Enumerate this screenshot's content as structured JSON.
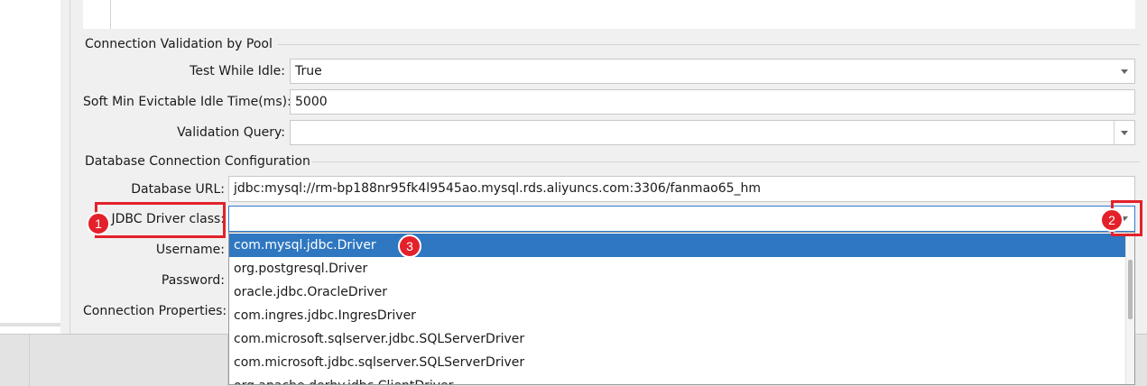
{
  "sections": {
    "validation_title": "Connection Validation by Pool",
    "db_config_title": "Database Connection Configuration"
  },
  "fields": {
    "test_while_idle": {
      "label": "Test While Idle:",
      "value": "True"
    },
    "soft_min_idle": {
      "label": "Soft Min Evictable Idle Time(ms):",
      "value": "5000"
    },
    "validation_query": {
      "label": "Validation Query:",
      "value": ""
    },
    "database_url": {
      "label": "Database URL:",
      "value": "jdbc:mysql://rm-bp188nr95fk4l9545ao.mysql.rds.aliyuncs.com:3306/fanmao65_hm"
    },
    "jdbc_driver": {
      "label": "JDBC Driver class:",
      "value": ""
    },
    "username": {
      "label": "Username:"
    },
    "password": {
      "label": "Password:"
    },
    "connection_properties": {
      "label": "Connection Properties:"
    }
  },
  "dropdown": {
    "options": [
      "com.mysql.jdbc.Driver",
      "org.postgresql.Driver",
      "oracle.jdbc.OracleDriver",
      "com.ingres.jdbc.IngresDriver",
      "com.microsoft.sqlserver.jdbc.SQLServerDriver",
      "com.microsoft.jdbc.sqlserver.SQLServerDriver",
      "org.apache.derby.jdbc.ClientDriver"
    ],
    "selected": "com.mysql.jdbc.Driver"
  },
  "callouts": {
    "one": "1",
    "two": "2",
    "three": "3"
  },
  "colors": {
    "selection": "#2f77c1",
    "callout": "#e3212a",
    "focus_border": "#2e7bd1"
  },
  "icons": {
    "combo_arrow": "chevron-down-icon"
  }
}
